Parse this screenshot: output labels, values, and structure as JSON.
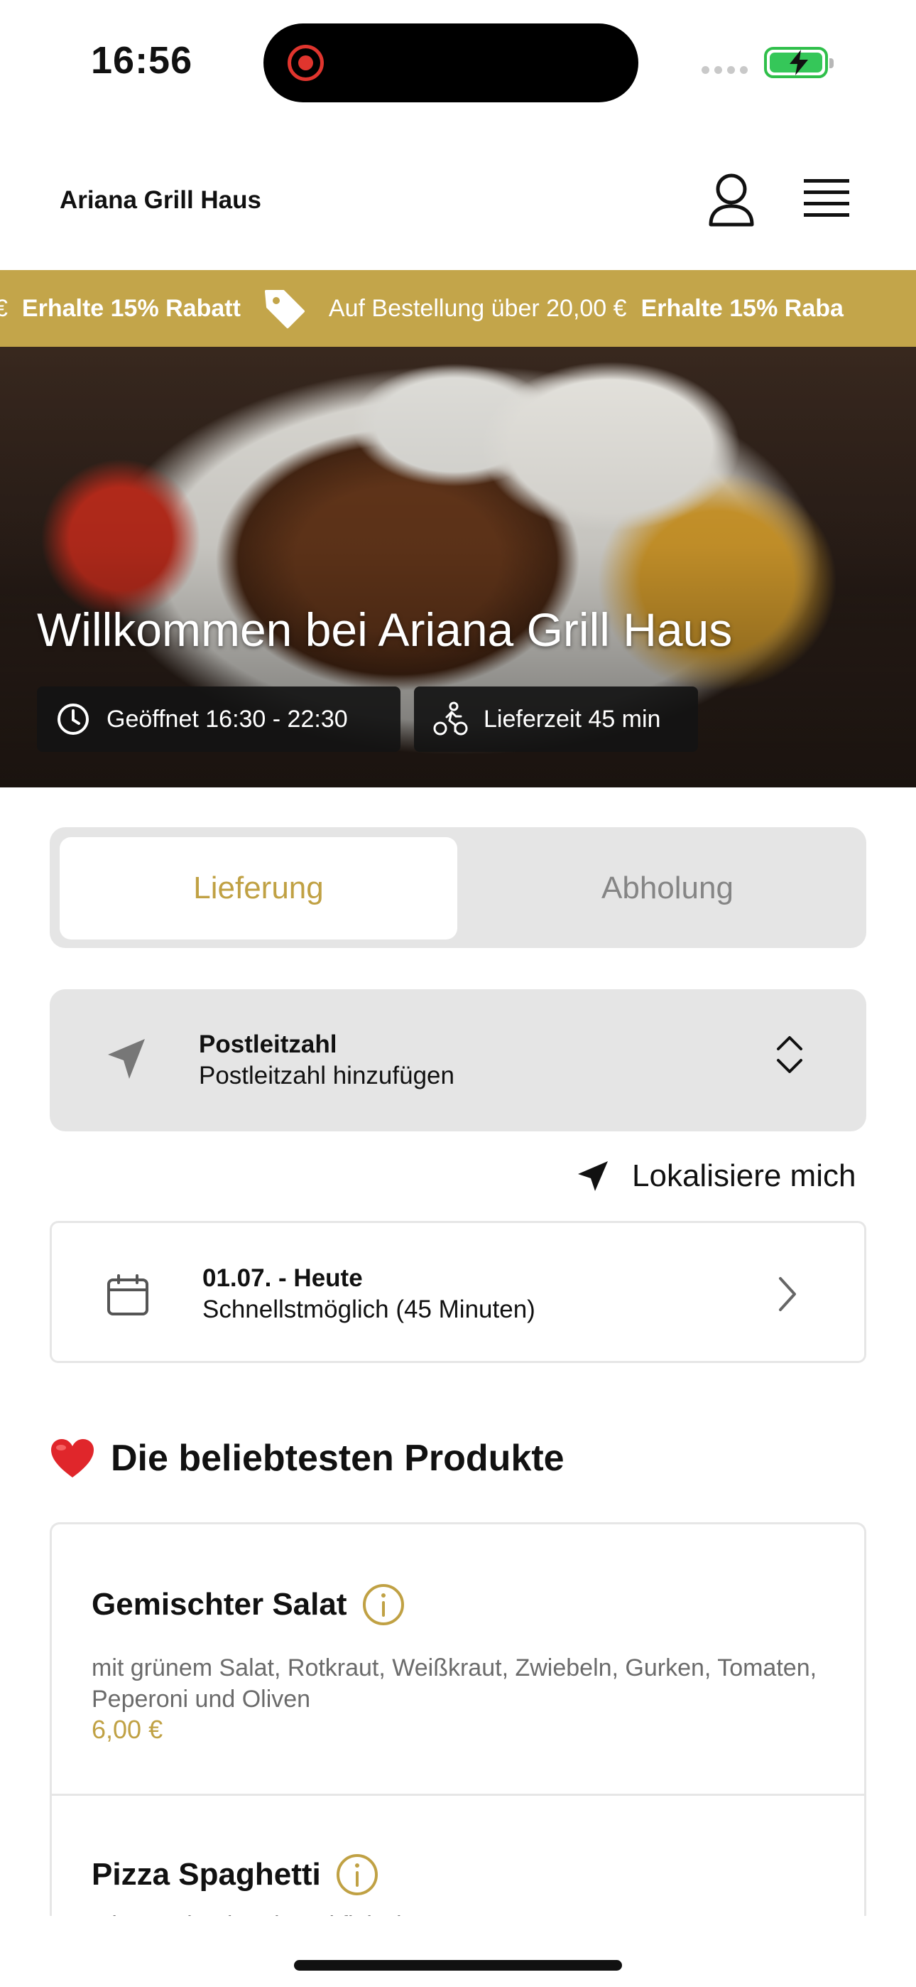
{
  "status_bar": {
    "time": "16:56"
  },
  "header": {
    "brand": "Ariana Grill Haus"
  },
  "promo": {
    "lead_fragment": "€",
    "bold_text_1": "Erhalte 15% Rabatt",
    "condition": "Auf Bestellung über 20,00 €",
    "bold_text_2": "Erhalte 15% Raba",
    "accent_color": "#c3a54a"
  },
  "hero": {
    "title": "Willkommen bei Ariana Grill Haus",
    "opening_hours": "Geöffnet 16:30 - 22:30",
    "delivery_time": "Lieferzeit 45 min"
  },
  "mode_toggle": {
    "options": [
      "Lieferung",
      "Abholung"
    ],
    "selected": "Lieferung"
  },
  "postcode": {
    "label": "Postleitzahl",
    "placeholder": "Postleitzahl hinzufügen"
  },
  "locate": {
    "label": "Lokalisiere mich"
  },
  "delivery_date": {
    "title": "01.07. - Heute",
    "subtitle": "Schnellstmöglich (45 Minuten)"
  },
  "popular": {
    "title": "Die beliebtesten Produkte",
    "products": [
      {
        "name": "Gemischter Salat",
        "description": "mit grünem Salat, Rotkraut, Weißkraut, Zwiebeln, Gurken, Tomaten, Peperoni und Oliven",
        "price": "6,00 €"
      },
      {
        "name": "Pizza Spaghetti",
        "description": "mit Spaghetti und Hackfleischsauce"
      }
    ]
  },
  "colors": {
    "accent": "#c0a144",
    "chip_bg": "#141414",
    "panel_bg": "#e5e5e5"
  }
}
